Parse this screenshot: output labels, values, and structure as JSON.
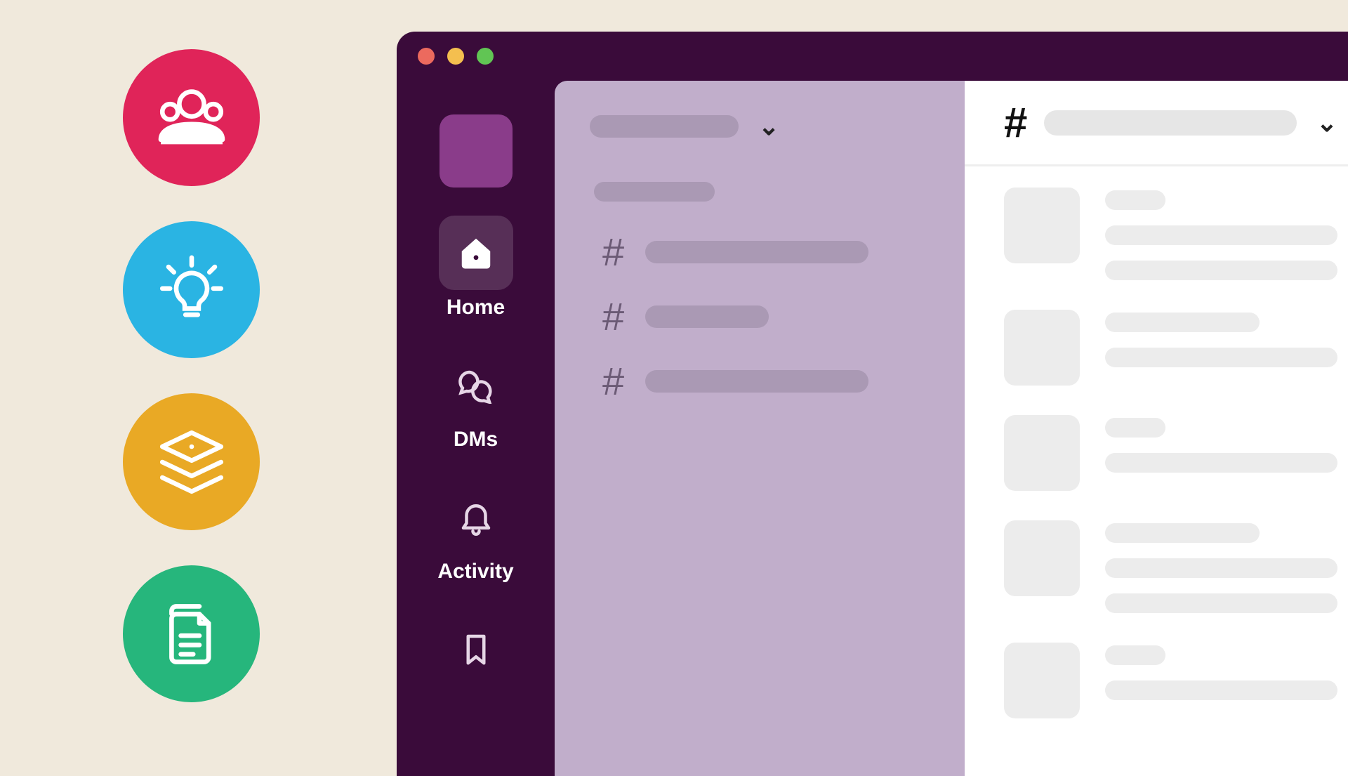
{
  "feature_circles": [
    {
      "id": "people",
      "color": "#e02459",
      "icon": "people-icon"
    },
    {
      "id": "idea",
      "color": "#2ab4e3",
      "icon": "lightbulb-icon"
    },
    {
      "id": "stack",
      "color": "#e9a925",
      "icon": "stack-icon"
    },
    {
      "id": "docs",
      "color": "#26b67c",
      "icon": "documents-icon"
    }
  ],
  "window": {
    "traffic_lights": {
      "close": "#ec6a5e",
      "minimize": "#f4bf4f",
      "zoom": "#61c554"
    }
  },
  "rail": {
    "items": [
      {
        "id": "home",
        "label": "Home",
        "active": true
      },
      {
        "id": "dms",
        "label": "DMs",
        "active": false
      },
      {
        "id": "activity",
        "label": "Activity",
        "active": false
      },
      {
        "id": "later",
        "label": "",
        "active": false
      }
    ]
  },
  "sidebar": {
    "channels": [
      {
        "length": "long"
      },
      {
        "length": "short"
      },
      {
        "length": "long"
      }
    ]
  },
  "main": {
    "messages": [
      {
        "lines": [
          "short",
          "long",
          "long"
        ]
      },
      {
        "lines": [
          "med",
          "long"
        ]
      },
      {
        "lines": [
          "short",
          "long"
        ]
      },
      {
        "lines": [
          "med",
          "long",
          "long"
        ]
      },
      {
        "lines": [
          "short",
          "long"
        ]
      }
    ]
  }
}
